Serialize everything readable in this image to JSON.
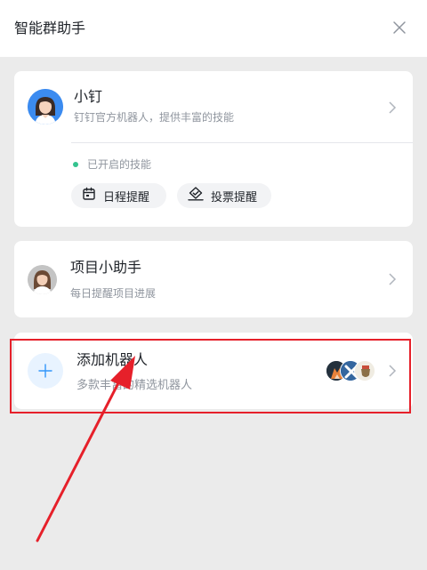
{
  "header": {
    "title": "智能群助手",
    "close_icon": "close-icon"
  },
  "cards": {
    "xiaoding": {
      "name": "小钉",
      "description": "钉钉官方机器人，提供丰富的技能",
      "status": "已开启的技能",
      "skills": [
        {
          "label": "日程提醒",
          "icon": "calendar-icon"
        },
        {
          "label": "投票提醒",
          "icon": "vote-icon"
        }
      ]
    },
    "project_assistant": {
      "name": "项目小助手",
      "description": "每日提醒项目进展"
    },
    "add_robot": {
      "name": "添加机器人",
      "description": "多款丰富的精选机器人"
    }
  },
  "colors": {
    "accent_blue": "#3296fa",
    "status_green": "#34c38f",
    "highlight_red": "#e6202a",
    "background_gray": "#ebebeb"
  }
}
